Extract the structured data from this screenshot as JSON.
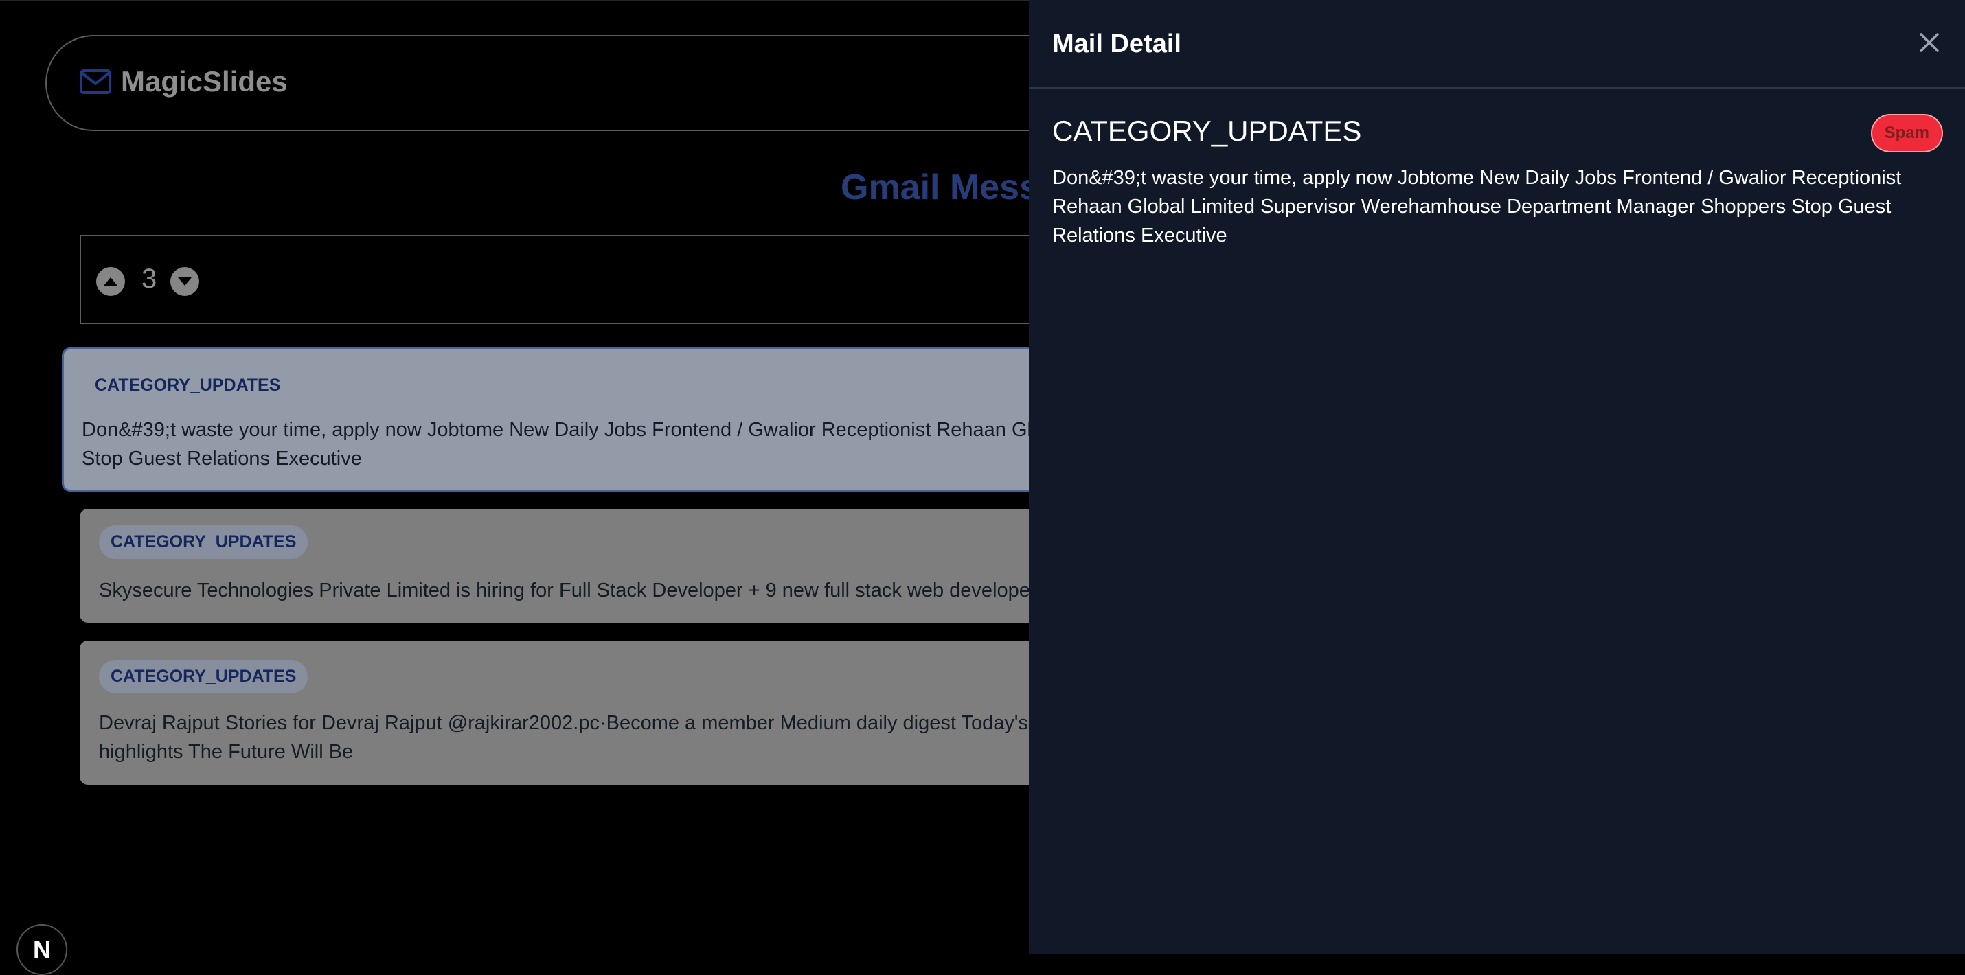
{
  "app": {
    "brand_name": "MagicSlides",
    "brand_icon": "mail-icon",
    "page_heading": "Gmail Messages",
    "pager": {
      "count": "3",
      "up_icon": "chevron-up-circle-icon",
      "down_icon": "chevron-down-circle-icon"
    },
    "mails": [
      {
        "category": "CATEGORY_UPDATES",
        "snippet": "Don&#39;t waste your time, apply now Jobtome New Daily Jobs Frontend / Gwalior Receptionist Rehaan Global Limited Supervisor Werehamhouse Department Manager Shoppers Stop Guest Relations Executive",
        "selected": true
      },
      {
        "category": "CATEGORY_UPDATES",
        "snippet": "Skysecure Technologies Private Limited is hiring for Full Stack Developer + 9 new full stack web developer jobs",
        "selected": false
      },
      {
        "category": "CATEGORY_UPDATES",
        "snippet": "Devraj Rajput Stories for Devraj Rajput @rajkirar2002.pc·Become a member Medium daily digest Today's highlights The Future Will Be",
        "selected": false
      }
    ],
    "framework_badge": "N"
  },
  "drawer": {
    "title": "Mail Detail",
    "close_icon": "close-icon",
    "subject": "CATEGORY_UPDATES",
    "badge": "Spam",
    "body": "Don&#39;t waste your time, apply now Jobtome New Daily Jobs Frontend / Gwalior Receptionist Rehaan Global Limited Supervisor Werehamhouse Department Manager Shoppers Stop Guest Relations Executive"
  },
  "colors": {
    "accent": "#3b5bb5",
    "drawer_bg": "#111827",
    "spam_red": "#ef2b3b",
    "tag_text": "#1e3a8a"
  }
}
